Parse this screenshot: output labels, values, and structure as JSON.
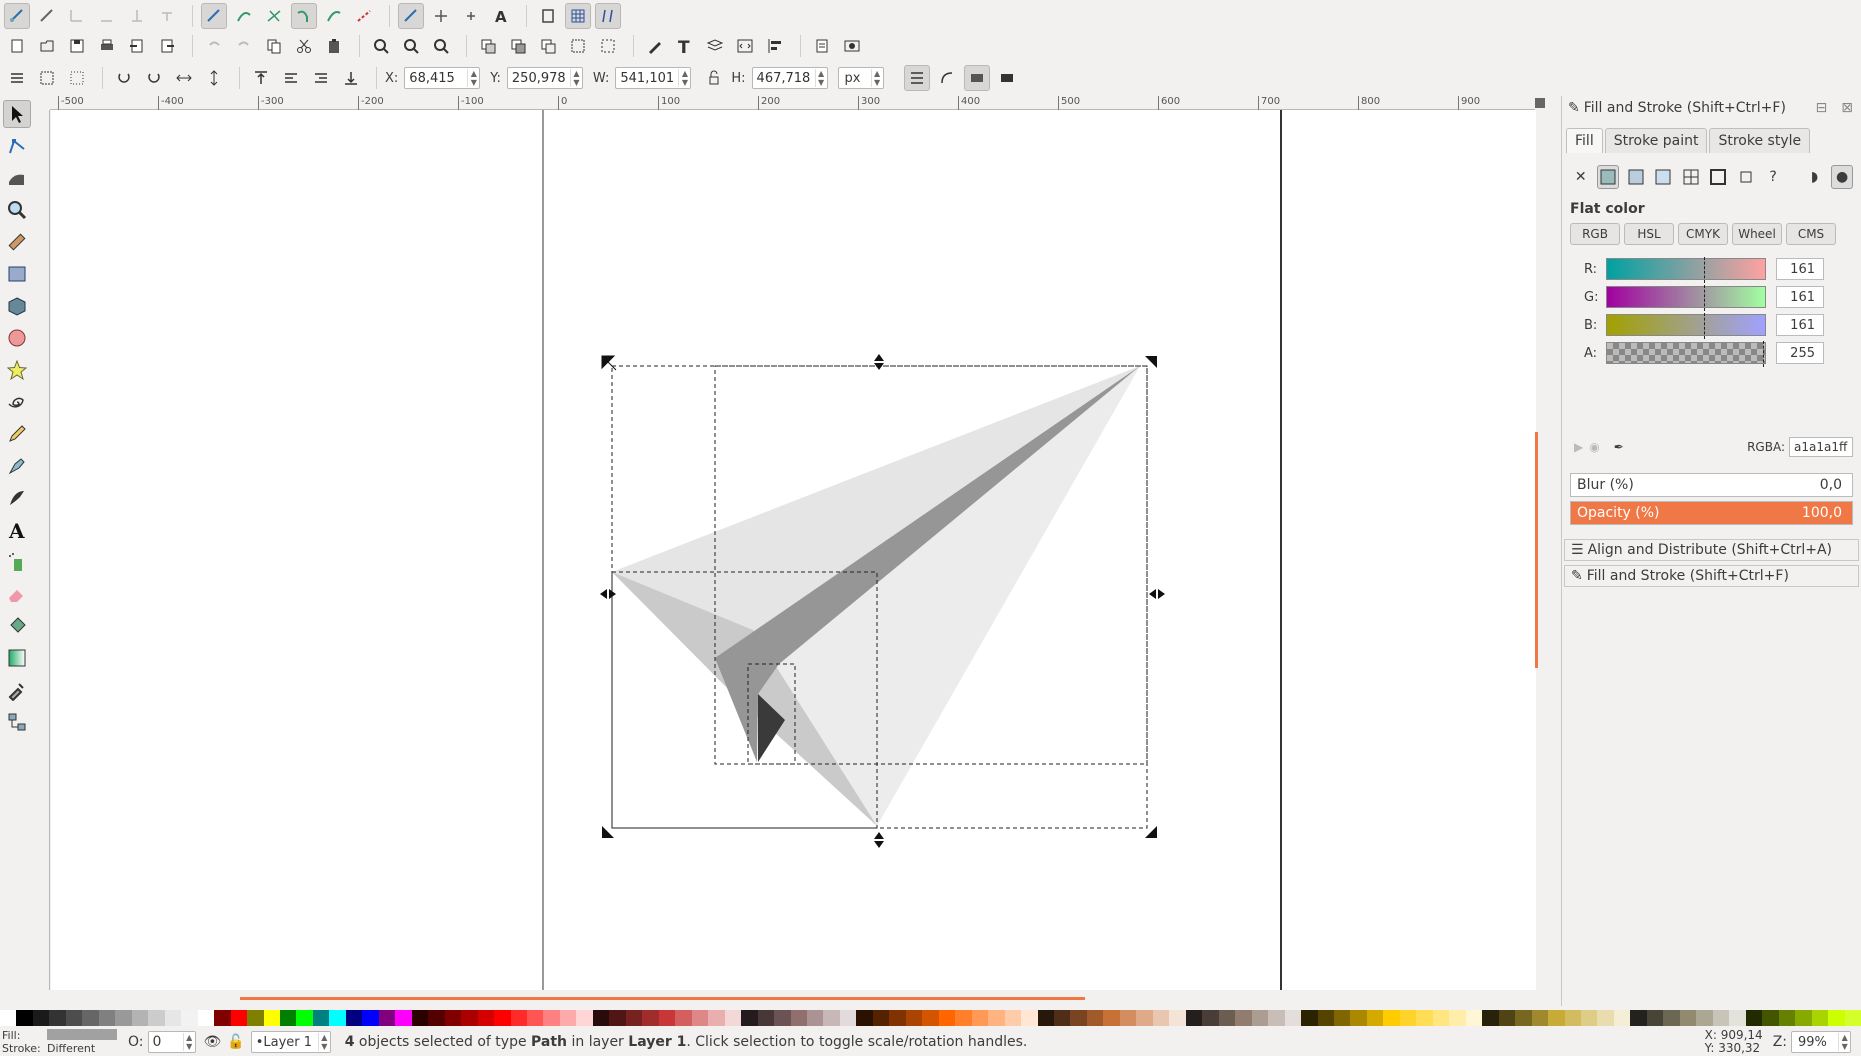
{
  "controls": {
    "x_label": "X:",
    "x_value": "68,415",
    "y_label": "Y:",
    "y_value": "250,978",
    "w_label": "W:",
    "w_value": "541,101",
    "h_label": "H:",
    "h_value": "467,718",
    "unit": "px"
  },
  "ruler_ticks": [
    "-500",
    "-400",
    "-300",
    "-200",
    "-100",
    "0",
    "100",
    "200",
    "300",
    "400",
    "500",
    "600",
    "700",
    "800",
    "900"
  ],
  "panel": {
    "title": "Fill and Stroke (Shift+Ctrl+F)",
    "tabs": [
      "Fill",
      "Stroke paint",
      "Stroke style"
    ],
    "flat_color": "Flat color",
    "modes": [
      "RGB",
      "HSL",
      "CMYK",
      "Wheel",
      "CMS"
    ],
    "channels": [
      {
        "label": "R:",
        "value": "161",
        "grad": "linear-gradient(90deg,#00a1a1,#ffa1a1)"
      },
      {
        "label": "G:",
        "value": "161",
        "grad": "linear-gradient(90deg,#a100a1,#a1ffa1)"
      },
      {
        "label": "B:",
        "value": "161",
        "grad": "linear-gradient(90deg,#a1a100,#a1a1ff)"
      },
      {
        "label": "A:",
        "value": "255",
        "grad": "repeating-conic-gradient(#888 0 25%,#bbb 0 50%) 0 0/12px 12px"
      }
    ],
    "rgba_label": "RGBA:",
    "rgba_value": "a1a1a1ff",
    "blur_label": "Blur (%)",
    "blur_value": "0,0",
    "opacity_label": "Opacity (%)",
    "opacity_value": "100,0",
    "dock_align": "Align and Distribute (Shift+Ctrl+A)",
    "dock_fill": "Fill and Stroke (Shift+Ctrl+F)"
  },
  "status": {
    "fill_label": "Fill:",
    "stroke_label": "Stroke:",
    "stroke_value": "Different",
    "opacity_label": "O:",
    "opacity_value": "0",
    "layer": "•Layer 1",
    "msg_count": "4",
    "msg_part1": " objects selected of type ",
    "msg_type": "Path",
    "msg_part2": " in layer ",
    "msg_layer": "Layer 1",
    "msg_part3": ". Click selection to toggle scale/rotation handles.",
    "coord_x": "X: 909,14",
    "coord_y": "Y: 330,32",
    "zoom_label": "Z:",
    "zoom_value": "99%"
  },
  "colors": {
    "accent": "#f07746",
    "selected_fill": "#a1a1a1"
  }
}
